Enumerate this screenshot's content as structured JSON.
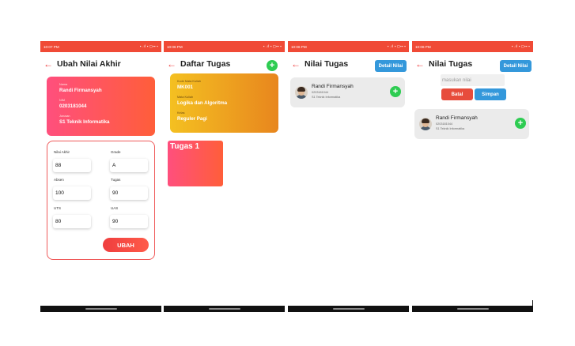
{
  "screens": [
    {
      "status_time": "10:07 PM",
      "title": "Ubah Nilai Akhir",
      "profile": {
        "nama_label": "Nama",
        "nama": "Randi Firmansyah",
        "nim_label": "NIM",
        "nim": "0203181044",
        "jurusan_label": "Jurusan",
        "jurusan": "S1 Teknik Informatika"
      },
      "form": {
        "nilai_akhir_label": "Nilai Akhir",
        "nilai_akhir": "88",
        "grade_label": "Grade",
        "grade": "A",
        "absen_label": "Absen",
        "absen": "100",
        "tugas_label": "Tugas",
        "tugas": "90",
        "uts_label": "UTS",
        "uts": "80",
        "uas_label": "UAS",
        "uas": "90"
      },
      "submit_label": "UBAH"
    },
    {
      "status_time": "10:06 PM",
      "title": "Daftar Tugas",
      "add_icon": "+",
      "course": {
        "kode_label": "Kode Mata Kuliah",
        "kode": "MK001",
        "matkul_label": "Mata Kuliah",
        "matkul": "Logika dan Algoritma",
        "kelas_label": "Kelas",
        "kelas": "Reguler Pagi"
      },
      "tugas_item": "Tugas 1"
    },
    {
      "status_time": "10:06 PM",
      "title": "Nilai Tugas",
      "detail_button": "Detail Nilai",
      "student": {
        "name": "Randi Firmansyah",
        "nim": "0203181044",
        "jurusan": "S1 Teknik Informatika"
      },
      "add_icon": "+"
    },
    {
      "status_time": "10:06 PM",
      "title": "Nilai Tugas",
      "detail_button": "Detail Nilai",
      "input_placeholder": "masukan nilai",
      "batal_label": "Batal",
      "simpan_label": "Simpan",
      "student": {
        "name": "Randi Firmansyah",
        "nim": "0203181044",
        "jurusan": "S1 Teknik Informatika"
      },
      "add_icon": "+"
    }
  ],
  "status_right": "▪ .ıl ▪ ◻▪▪ ▪",
  "back_icon": "←",
  "colors": {
    "accent_red": "#f04a36",
    "green": "#2ecc52",
    "blue": "#3498db",
    "gold": "#f4c021"
  }
}
